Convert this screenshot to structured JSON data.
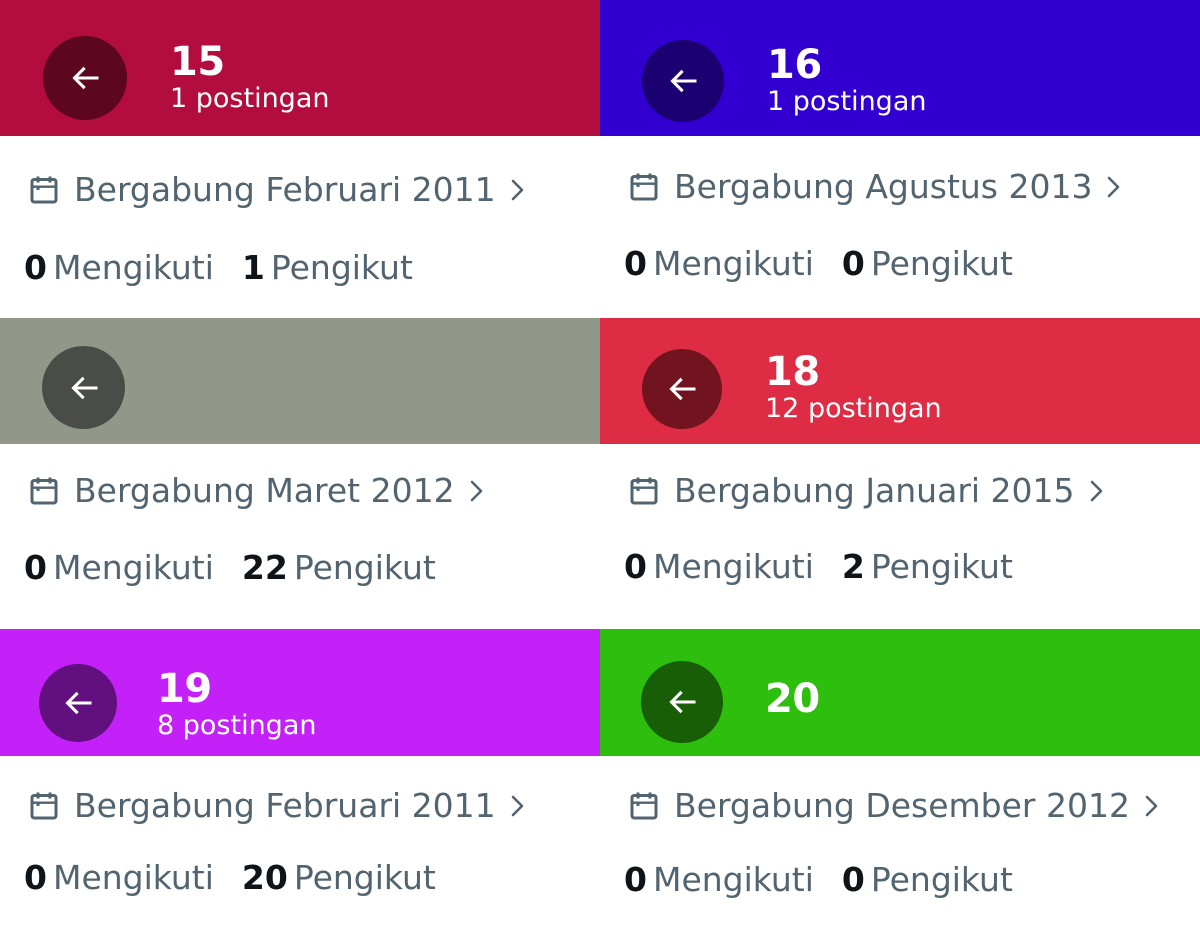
{
  "profiles": [
    {
      "banner_color": "#b30c3e",
      "button_color": "#5c0620",
      "title": "15",
      "subtitle": "1 postingan",
      "joined": "Bergabung Februari 2011",
      "following_count": "0",
      "following_label": "Mengikuti",
      "followers_count": "1",
      "followers_label": "Pengikut"
    },
    {
      "banner_color": "#3100d0",
      "button_color": "#1a0070",
      "title": "16",
      "subtitle": "1 postingan",
      "joined": "Bergabung Agustus 2013",
      "following_count": "0",
      "following_label": "Mengikuti",
      "followers_count": "0",
      "followers_label": "Pengikut"
    },
    {
      "banner_color": "#919889",
      "button_color": "#4a4d47",
      "title": "",
      "subtitle": "",
      "joined": "Bergabung Maret 2012",
      "following_count": "0",
      "following_label": "Mengikuti",
      "followers_count": "22",
      "followers_label": "Pengikut"
    },
    {
      "banner_color": "#dd2c44",
      "button_color": "#71141f",
      "title": "18",
      "subtitle": "12 postingan",
      "joined": "Bergabung Januari 2015",
      "following_count": "0",
      "following_label": "Mengikuti",
      "followers_count": "2",
      "followers_label": "Pengikut"
    },
    {
      "banner_color": "#c321f7",
      "button_color": "#621080",
      "title": "19",
      "subtitle": "8 postingan",
      "joined": "Bergabung Februari 2011",
      "following_count": "0",
      "following_label": "Mengikuti",
      "followers_count": "20",
      "followers_label": "Pengikut"
    },
    {
      "banner_color": "#2ebe0d",
      "button_color": "#175e06",
      "title": "20",
      "subtitle": "",
      "joined": "Bergabung Desember 2012",
      "following_count": "0",
      "following_label": "Mengikuti",
      "followers_count": "0",
      "followers_label": "Pengikut"
    }
  ],
  "icons": {
    "back": "arrow-left-icon",
    "joined": "calendar-icon",
    "more": "chevron-right-icon"
  }
}
